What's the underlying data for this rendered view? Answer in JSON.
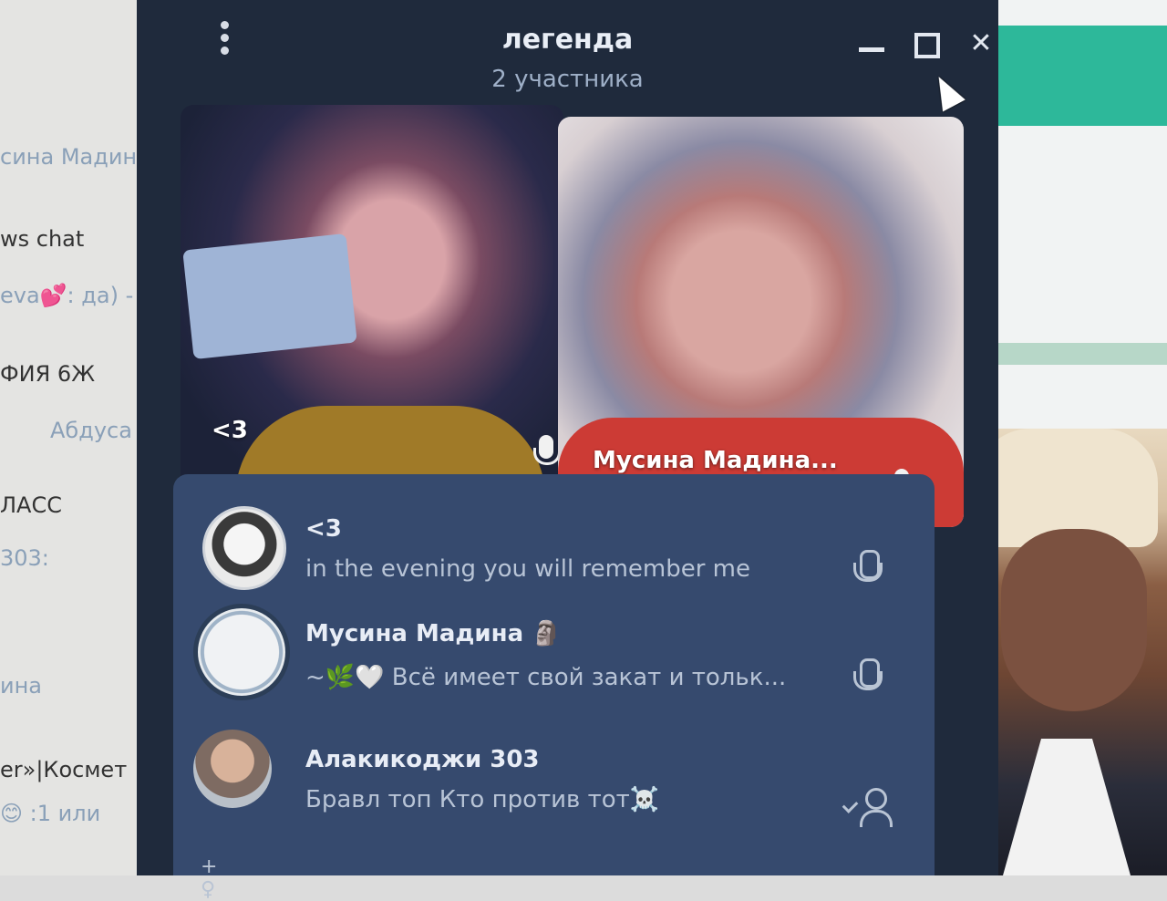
{
  "background_chats": [
    {
      "text": "сина Мадин"
    },
    {
      "text": "ws chat"
    },
    {
      "text": "eva💕: да) -"
    },
    {
      "text": "ФИЯ 6Ж"
    },
    {
      "text": "Абдуса"
    },
    {
      "text": "ЛАСС"
    },
    {
      "text": "303: "
    },
    {
      "text": "ина "
    },
    {
      "text": "er»|Космет"
    },
    {
      "text": "😊 :1 или"
    }
  ],
  "call": {
    "title": "легенда",
    "subtitle": "2 участника",
    "window_controls": {
      "minimize": "",
      "maximize": "",
      "close": "✕"
    },
    "videos": [
      {
        "name": "<3"
      },
      {
        "name": "Мусина Мадина..."
      }
    ],
    "participants": [
      {
        "name": "<3",
        "status": "in the evening you will remember me",
        "action_icon": "mic-icon"
      },
      {
        "name": "Мусина Мадина 🗿",
        "status": "~🌿🤍 Всё имеет свой закат и тольк...",
        "action_icon": "mic-icon"
      },
      {
        "name": "Алакикоджи 303",
        "status": "Бравл топ Кто против тот☠️",
        "action_icon": "add-user-icon"
      }
    ],
    "invite_label": "+ ♀"
  }
}
